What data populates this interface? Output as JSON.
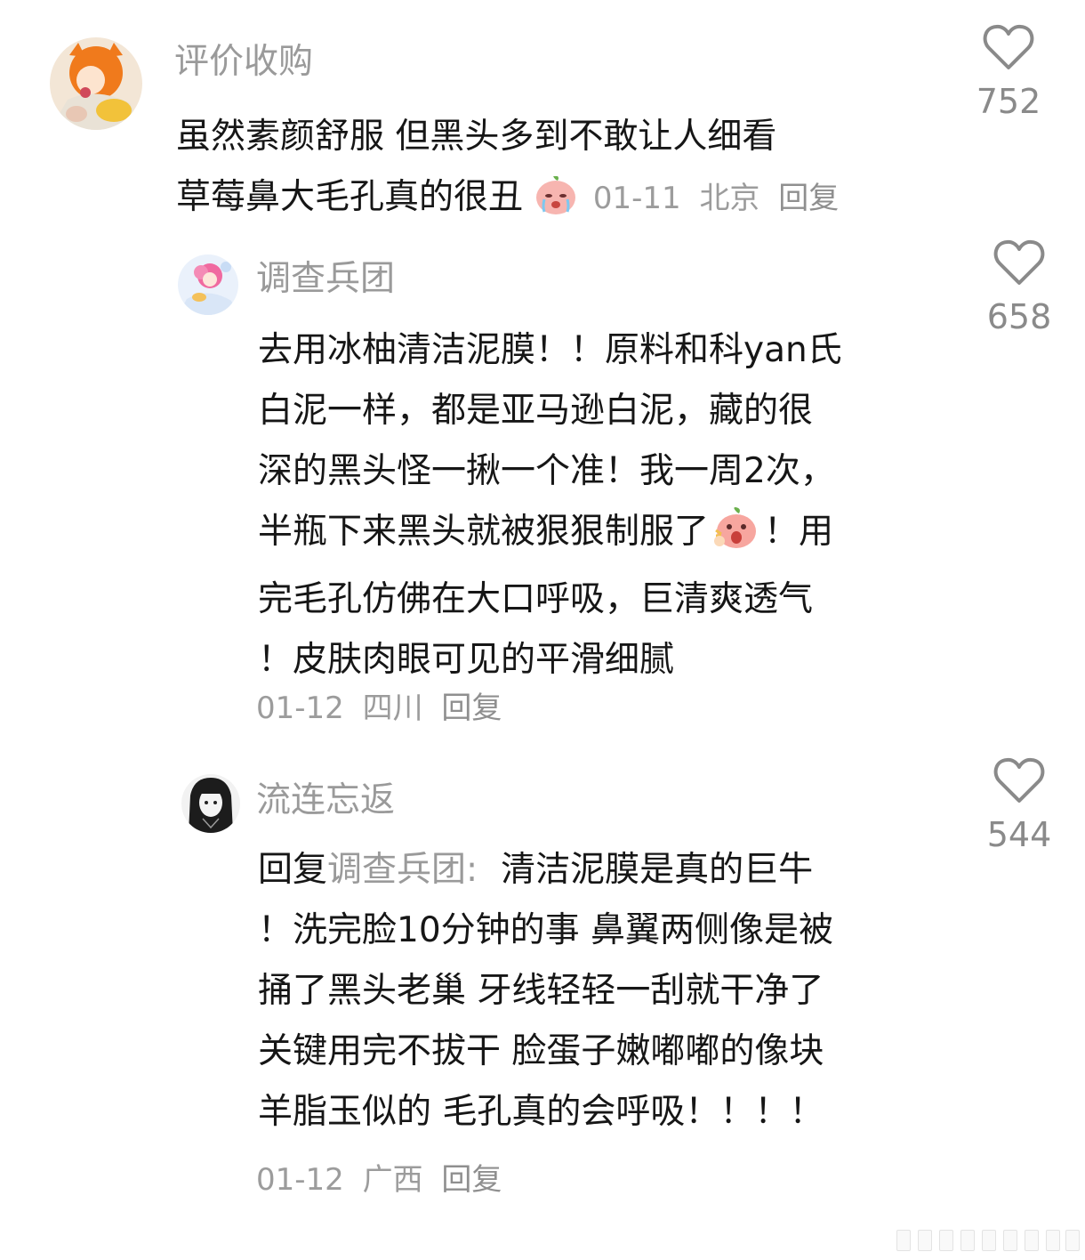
{
  "comments": [
    {
      "username": "评价收购",
      "lines": [
        "虽然素颜舒服 但黑头多到不敢让人细看",
        "草莓鼻大毛孔真的很丑"
      ],
      "date": "01-11",
      "location": "北京",
      "reply_label": "回复",
      "likes": "752",
      "emoji": "crying-peach-emoji"
    },
    {
      "username": "调查兵团",
      "lines": [
        "去用冰柚清洁泥膜！！原料和科yan氏",
        "白泥一样，都是亚马逊白泥，藏的很",
        "深的黑头怪一揪一个准！我一周2次，",
        "半瓶下来黑头就被狠狠制服了",
        "完毛孔仿佛在大口呼吸，巨清爽透气",
        "！皮肤肉眼可见的平滑细腻"
      ],
      "line4_tail": "！用",
      "date": "01-12",
      "location": "四川",
      "reply_label": "回复",
      "likes": "658",
      "emoji": "surprised-peach-emoji"
    },
    {
      "username": "流连忘返",
      "reply_prefix": "回复",
      "reply_to": "调查兵团:",
      "lines": [
        "清洁泥膜是真的巨牛",
        "！洗完脸10分钟的事 鼻翼两侧像是被",
        "捅了黑头老巢 牙线轻轻一刮就干净了",
        "关键用完不拔干 脸蛋子嫩嘟嘟的像块",
        "羊脂玉似的 毛孔真的会呼吸！！！！"
      ],
      "date": "01-12",
      "location": "广西",
      "reply_label": "回复",
      "likes": "544"
    }
  ],
  "icons": {
    "like": "heart-outline-icon"
  },
  "colors": {
    "username": "#9a9a9a",
    "body": "#161616",
    "meta": "#9c9c9c",
    "like_icon": "#8a8a8a"
  }
}
